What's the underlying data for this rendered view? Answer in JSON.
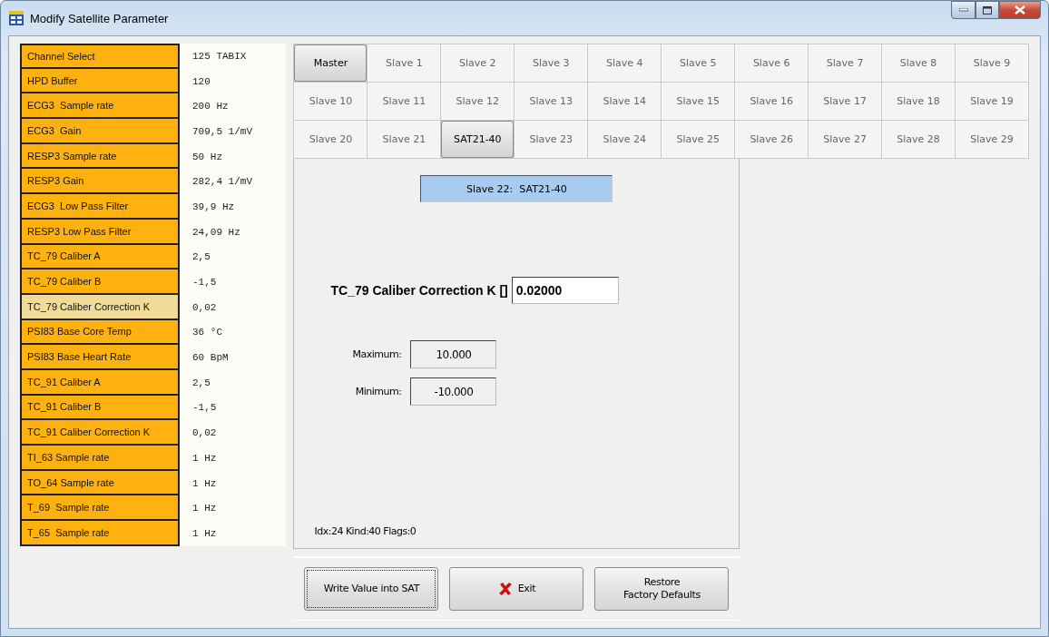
{
  "window": {
    "title": "Modify Satellite Parameter"
  },
  "parameters": [
    {
      "label": "Channel Select",
      "value": "125 TABIX",
      "selected": false
    },
    {
      "label": "HPD Buffer",
      "value": "120",
      "selected": false
    },
    {
      "label": "ECG3  Sample rate",
      "value": "200 Hz",
      "selected": false
    },
    {
      "label": "ECG3  Gain",
      "value": "709,5 1/mV",
      "selected": false
    },
    {
      "label": "RESP3 Sample rate",
      "value": "50 Hz",
      "selected": false
    },
    {
      "label": "RESP3 Gain",
      "value": "282,4 1/mV",
      "selected": false
    },
    {
      "label": "ECG3  Low Pass Filter",
      "value": "39,9 Hz",
      "selected": false
    },
    {
      "label": "RESP3 Low Pass Filter",
      "value": "24,09 Hz",
      "selected": false
    },
    {
      "label": "TC_79 Caliber A",
      "value": "2,5",
      "selected": false
    },
    {
      "label": "TC_79 Caliber B",
      "value": "-1,5",
      "selected": false
    },
    {
      "label": "TC_79 Caliber Correction K",
      "value": "0,02",
      "selected": true
    },
    {
      "label": "PSI83 Base Core Temp",
      "value": "36 °C",
      "selected": false
    },
    {
      "label": "PSI83 Base Heart Rate",
      "value": "60 BpM",
      "selected": false
    },
    {
      "label": "TC_91 Caliber A",
      "value": "2,5",
      "selected": false
    },
    {
      "label": "TC_91 Caliber B",
      "value": "-1,5",
      "selected": false
    },
    {
      "label": "TC_91 Caliber Correction K",
      "value": "0,02",
      "selected": false
    },
    {
      "label": "TI_63 Sample rate",
      "value": "1 Hz",
      "selected": false
    },
    {
      "label": "TO_64 Sample rate",
      "value": "1 Hz",
      "selected": false
    },
    {
      "label": "T_69  Sample rate",
      "value": "1 Hz",
      "selected": false
    },
    {
      "label": "T_65  Sample rate",
      "value": "1 Hz",
      "selected": false
    }
  ],
  "units": [
    {
      "label": "Master",
      "selected": true
    },
    {
      "label": "Slave 1",
      "selected": false
    },
    {
      "label": "Slave 2",
      "selected": false
    },
    {
      "label": "Slave 3",
      "selected": false
    },
    {
      "label": "Slave 4",
      "selected": false
    },
    {
      "label": "Slave 5",
      "selected": false
    },
    {
      "label": "Slave 6",
      "selected": false
    },
    {
      "label": "Slave 7",
      "selected": false
    },
    {
      "label": "Slave 8",
      "selected": false
    },
    {
      "label": "Slave 9",
      "selected": false
    },
    {
      "label": "Slave 10",
      "selected": false
    },
    {
      "label": "Slave 11",
      "selected": false
    },
    {
      "label": "Slave 12",
      "selected": false
    },
    {
      "label": "Slave 13",
      "selected": false
    },
    {
      "label": "Slave 14",
      "selected": false
    },
    {
      "label": "Slave 15",
      "selected": false
    },
    {
      "label": "Slave 16",
      "selected": false
    },
    {
      "label": "Slave 17",
      "selected": false
    },
    {
      "label": "Slave 18",
      "selected": false
    },
    {
      "label": "Slave 19",
      "selected": false
    },
    {
      "label": "Slave 20",
      "selected": false
    },
    {
      "label": "Slave 21",
      "selected": false
    },
    {
      "label": "SAT21-40",
      "selected": true
    },
    {
      "label": "Slave 23",
      "selected": false
    },
    {
      "label": "Slave 24",
      "selected": false
    },
    {
      "label": "Slave 25",
      "selected": false
    },
    {
      "label": "Slave 26",
      "selected": false
    },
    {
      "label": "Slave 27",
      "selected": false
    },
    {
      "label": "Slave 28",
      "selected": false
    },
    {
      "label": "Slave 29",
      "selected": false
    }
  ],
  "editor": {
    "heading": "Slave 22:  SAT21-40",
    "parameter_label": "TC_79 Caliber Correction K []",
    "value": "0.02000",
    "limits": [
      {
        "label": "Maximum:",
        "value": "10.000"
      },
      {
        "label": "Minimum:",
        "value": "-10.000"
      }
    ],
    "info": "Idx:24  Kind:40  Flags:0"
  },
  "buttons": [
    {
      "label": "Write Value into SAT",
      "kind": "focused"
    },
    {
      "label": "Exit",
      "kind": "exit"
    },
    {
      "label": "Restore\nFactory Defaults",
      "kind": "plain"
    }
  ]
}
